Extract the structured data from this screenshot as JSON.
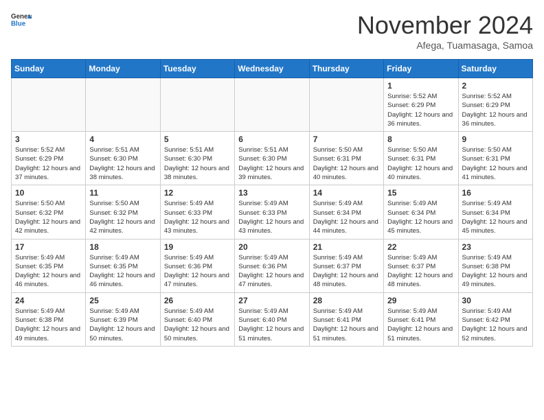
{
  "header": {
    "logo_general": "General",
    "logo_blue": "Blue",
    "month": "November 2024",
    "location": "Afega, Tuamasaga, Samoa"
  },
  "weekdays": [
    "Sunday",
    "Monday",
    "Tuesday",
    "Wednesday",
    "Thursday",
    "Friday",
    "Saturday"
  ],
  "weeks": [
    [
      {
        "day": "",
        "empty": true
      },
      {
        "day": "",
        "empty": true
      },
      {
        "day": "",
        "empty": true
      },
      {
        "day": "",
        "empty": true
      },
      {
        "day": "",
        "empty": true
      },
      {
        "day": "1",
        "sunrise": "5:52 AM",
        "sunset": "6:29 PM",
        "daylight": "12 hours and 36 minutes."
      },
      {
        "day": "2",
        "sunrise": "5:52 AM",
        "sunset": "6:29 PM",
        "daylight": "12 hours and 36 minutes."
      }
    ],
    [
      {
        "day": "3",
        "sunrise": "5:52 AM",
        "sunset": "6:29 PM",
        "daylight": "12 hours and 37 minutes."
      },
      {
        "day": "4",
        "sunrise": "5:51 AM",
        "sunset": "6:30 PM",
        "daylight": "12 hours and 38 minutes."
      },
      {
        "day": "5",
        "sunrise": "5:51 AM",
        "sunset": "6:30 PM",
        "daylight": "12 hours and 38 minutes."
      },
      {
        "day": "6",
        "sunrise": "5:51 AM",
        "sunset": "6:30 PM",
        "daylight": "12 hours and 39 minutes."
      },
      {
        "day": "7",
        "sunrise": "5:50 AM",
        "sunset": "6:31 PM",
        "daylight": "12 hours and 40 minutes."
      },
      {
        "day": "8",
        "sunrise": "5:50 AM",
        "sunset": "6:31 PM",
        "daylight": "12 hours and 40 minutes."
      },
      {
        "day": "9",
        "sunrise": "5:50 AM",
        "sunset": "6:31 PM",
        "daylight": "12 hours and 41 minutes."
      }
    ],
    [
      {
        "day": "10",
        "sunrise": "5:50 AM",
        "sunset": "6:32 PM",
        "daylight": "12 hours and 42 minutes."
      },
      {
        "day": "11",
        "sunrise": "5:50 AM",
        "sunset": "6:32 PM",
        "daylight": "12 hours and 42 minutes."
      },
      {
        "day": "12",
        "sunrise": "5:49 AM",
        "sunset": "6:33 PM",
        "daylight": "12 hours and 43 minutes."
      },
      {
        "day": "13",
        "sunrise": "5:49 AM",
        "sunset": "6:33 PM",
        "daylight": "12 hours and 43 minutes."
      },
      {
        "day": "14",
        "sunrise": "5:49 AM",
        "sunset": "6:34 PM",
        "daylight": "12 hours and 44 minutes."
      },
      {
        "day": "15",
        "sunrise": "5:49 AM",
        "sunset": "6:34 PM",
        "daylight": "12 hours and 45 minutes."
      },
      {
        "day": "16",
        "sunrise": "5:49 AM",
        "sunset": "6:34 PM",
        "daylight": "12 hours and 45 minutes."
      }
    ],
    [
      {
        "day": "17",
        "sunrise": "5:49 AM",
        "sunset": "6:35 PM",
        "daylight": "12 hours and 46 minutes."
      },
      {
        "day": "18",
        "sunrise": "5:49 AM",
        "sunset": "6:35 PM",
        "daylight": "12 hours and 46 minutes."
      },
      {
        "day": "19",
        "sunrise": "5:49 AM",
        "sunset": "6:36 PM",
        "daylight": "12 hours and 47 minutes."
      },
      {
        "day": "20",
        "sunrise": "5:49 AM",
        "sunset": "6:36 PM",
        "daylight": "12 hours and 47 minutes."
      },
      {
        "day": "21",
        "sunrise": "5:49 AM",
        "sunset": "6:37 PM",
        "daylight": "12 hours and 48 minutes."
      },
      {
        "day": "22",
        "sunrise": "5:49 AM",
        "sunset": "6:37 PM",
        "daylight": "12 hours and 48 minutes."
      },
      {
        "day": "23",
        "sunrise": "5:49 AM",
        "sunset": "6:38 PM",
        "daylight": "12 hours and 49 minutes."
      }
    ],
    [
      {
        "day": "24",
        "sunrise": "5:49 AM",
        "sunset": "6:38 PM",
        "daylight": "12 hours and 49 minutes."
      },
      {
        "day": "25",
        "sunrise": "5:49 AM",
        "sunset": "6:39 PM",
        "daylight": "12 hours and 50 minutes."
      },
      {
        "day": "26",
        "sunrise": "5:49 AM",
        "sunset": "6:40 PM",
        "daylight": "12 hours and 50 minutes."
      },
      {
        "day": "27",
        "sunrise": "5:49 AM",
        "sunset": "6:40 PM",
        "daylight": "12 hours and 51 minutes."
      },
      {
        "day": "28",
        "sunrise": "5:49 AM",
        "sunset": "6:41 PM",
        "daylight": "12 hours and 51 minutes."
      },
      {
        "day": "29",
        "sunrise": "5:49 AM",
        "sunset": "6:41 PM",
        "daylight": "12 hours and 51 minutes."
      },
      {
        "day": "30",
        "sunrise": "5:49 AM",
        "sunset": "6:42 PM",
        "daylight": "12 hours and 52 minutes."
      }
    ]
  ],
  "labels": {
    "sunrise": "Sunrise:",
    "sunset": "Sunset:",
    "daylight": "Daylight:"
  },
  "colors": {
    "header_bg": "#2176c7"
  }
}
